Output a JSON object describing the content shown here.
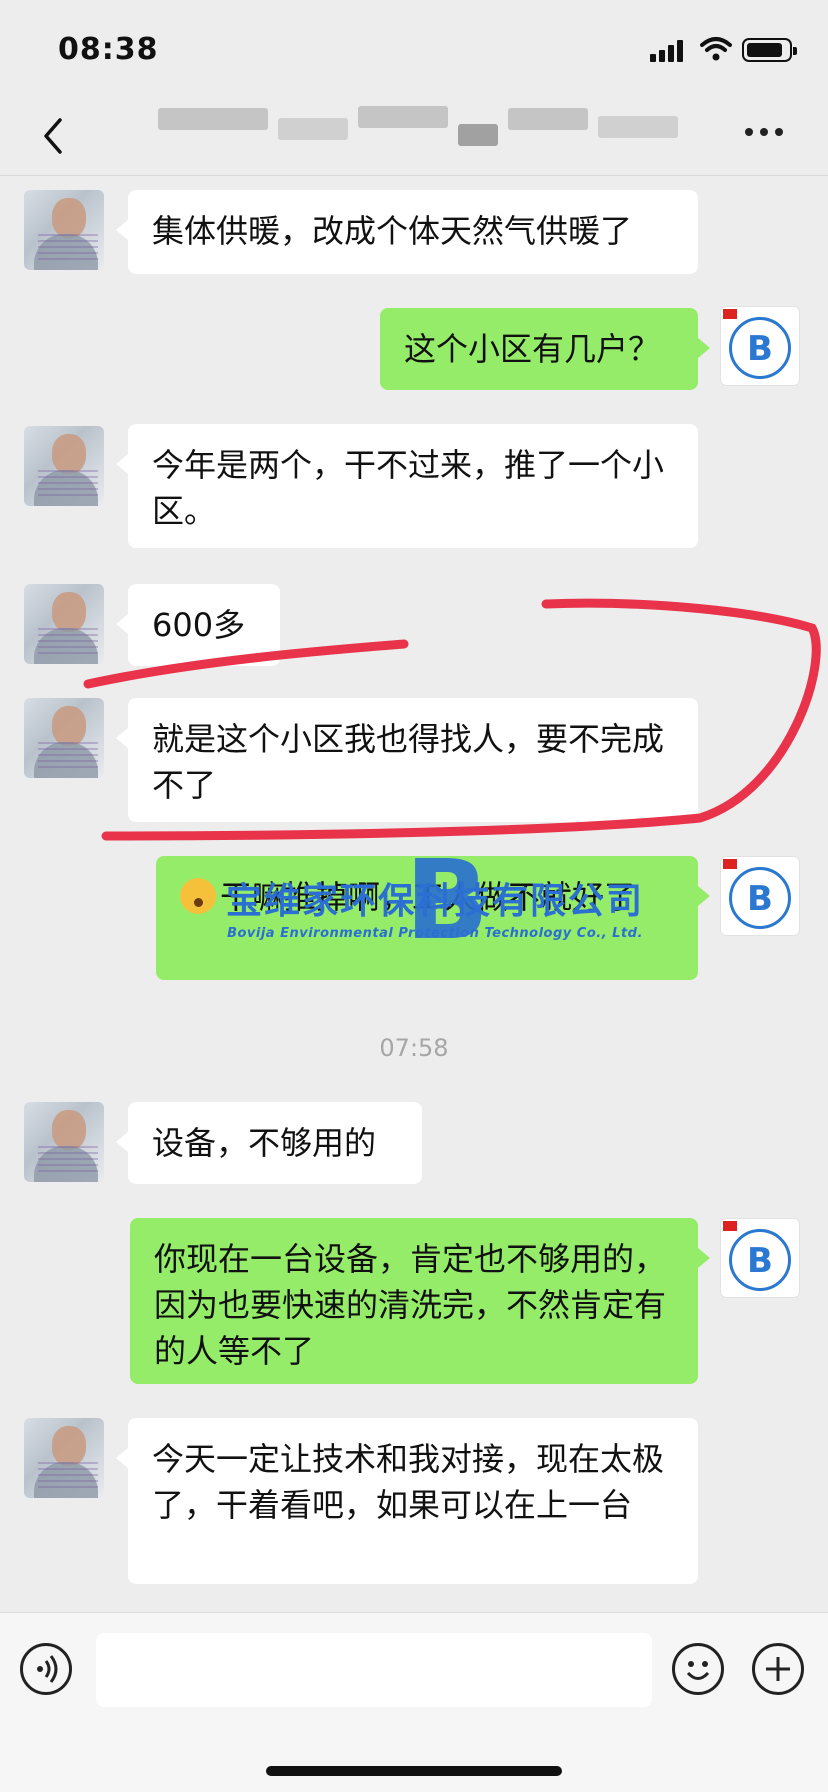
{
  "status": {
    "time": "08:38"
  },
  "nav": {
    "back_icon": "chevron-left-icon",
    "more_icon": "more-dots-icon"
  },
  "messages": [
    {
      "side": "left",
      "text": "集体供暖，改成个体天然气供暖了"
    },
    {
      "side": "right",
      "text": "这个小区有几户？"
    },
    {
      "side": "left",
      "text": "今年是两个，干不过来，推了一个小区。"
    },
    {
      "side": "left",
      "text": "600多"
    },
    {
      "side": "left",
      "text": "就是这个小区我也得找人，要不完成不了"
    },
    {
      "side": "right",
      "text": "干嘛推掉啊，工人做不就好了"
    },
    {
      "side": "left",
      "text": "设备，不够用的"
    },
    {
      "side": "right",
      "text": "你现在一台设备，肯定也不够用的，因为也要快速的清洗完，不然肯定有的人等不了"
    },
    {
      "side": "left",
      "text": "今天一定让技术和我对接，现在太极了，干着看吧，如果可以在上一台"
    }
  ],
  "timestamp": "07:58",
  "watermark": {
    "letter": "B",
    "title": "宝维家环保科技有限公司",
    "subtitle": "Bovija Environmental Protection Technology Co., Ltd."
  },
  "avatars": {
    "self_badge": "B"
  },
  "input": {
    "voice_icon": "voice-icon",
    "emoji_icon": "emoji-icon",
    "plus_icon": "plus-icon"
  },
  "colors": {
    "bubble_sent": "#95ec69",
    "bubble_received": "#ffffff",
    "background": "#ededed",
    "annotation": "#e8334a",
    "brand": "#2a6fd1"
  }
}
